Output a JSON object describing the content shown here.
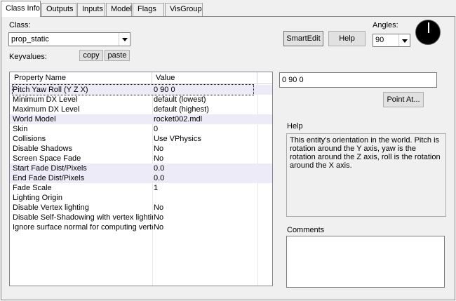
{
  "tabs": [
    {
      "label": "Class Info",
      "active": true
    },
    {
      "label": "Outputs"
    },
    {
      "label": "Inputs"
    },
    {
      "label": "Model"
    },
    {
      "label": "Flags"
    },
    {
      "label": "VisGroup"
    }
  ],
  "class_label": "Class:",
  "class_value": "prop_static",
  "keyvalues_label": "Keyvalues:",
  "copy_label": "copy",
  "paste_label": "paste",
  "smartedit_label": "SmartEdit",
  "help_button_label": "Help",
  "angles_label": "Angles:",
  "angles_value": "90",
  "grid": {
    "col_name": "Property Name",
    "col_value": "Value",
    "rows": [
      {
        "name": "Pitch Yaw Roll (Y Z X)",
        "value": "0 90 0"
      },
      {
        "name": "Minimum DX Level",
        "value": "default (lowest)"
      },
      {
        "name": "Maximum DX Level",
        "value": "default (highest)"
      },
      {
        "name": "World Model",
        "value": "rocket002.mdl"
      },
      {
        "name": "Skin",
        "value": "0"
      },
      {
        "name": "Collisions",
        "value": "Use VPhysics"
      },
      {
        "name": "Disable Shadows",
        "value": "No"
      },
      {
        "name": "Screen Space Fade",
        "value": "No"
      },
      {
        "name": "Start Fade Dist/Pixels",
        "value": "0.0"
      },
      {
        "name": "End Fade Dist/Pixels",
        "value": "0.0"
      },
      {
        "name": "Fade Scale",
        "value": "1"
      },
      {
        "name": "Lighting Origin",
        "value": ""
      },
      {
        "name": "Disable Vertex lighting",
        "value": "No"
      },
      {
        "name": "Disable Self-Shadowing with vertex lighting",
        "value": "No"
      },
      {
        "name": "Ignore surface normal for computing vertex lighting",
        "value": "No"
      }
    ]
  },
  "value_field": "0 90 0",
  "point_at_label": "Point At...",
  "help_label": "Help",
  "help_text": "This entity's orientation in the world. Pitch is rotation around the Y axis, yaw is the rotation around the Z axis, roll is the rotation around the X axis.",
  "comments_label": "Comments",
  "comments_value": ""
}
